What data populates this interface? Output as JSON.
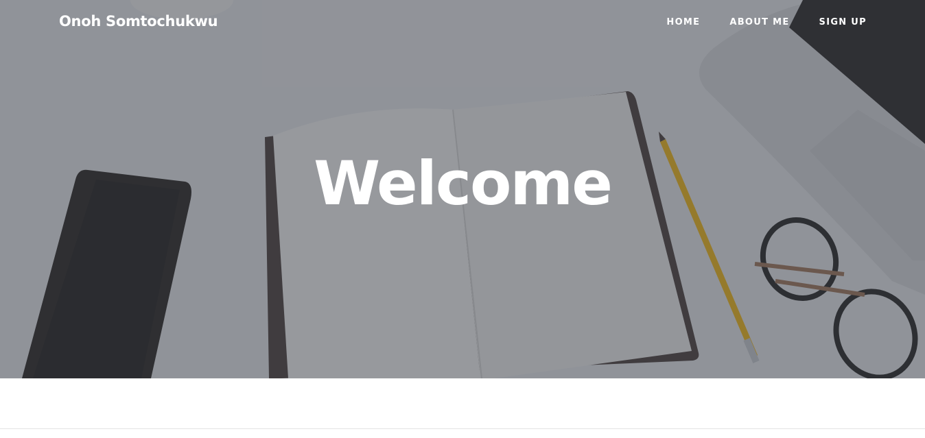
{
  "header": {
    "brand": "Onoh Somtochukwu",
    "nav": [
      {
        "label": "HOME"
      },
      {
        "label": "ABOUT ME"
      },
      {
        "label": "SIGN UP"
      }
    ]
  },
  "hero": {
    "title": "Welcome",
    "overlay_color": "#464850"
  }
}
